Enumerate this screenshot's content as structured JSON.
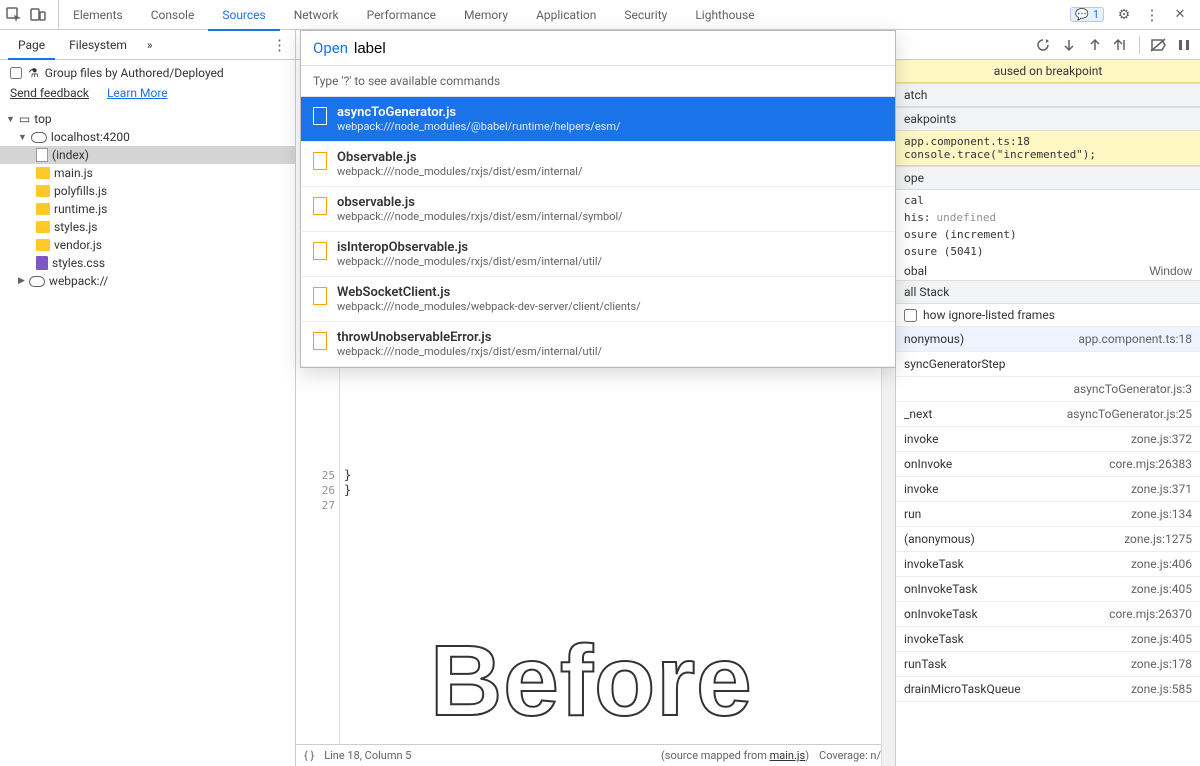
{
  "top_tabs": [
    "Elements",
    "Console",
    "Sources",
    "Network",
    "Performance",
    "Memory",
    "Application",
    "Security",
    "Lighthouse"
  ],
  "top_active": 2,
  "badge_count": "1",
  "second_tabs": {
    "page": "Page",
    "filesystem": "Filesystem"
  },
  "sidebar": {
    "group_label": "Group files by Authored/Deployed",
    "feedback": "Send feedback",
    "learn": "Learn More",
    "tree": {
      "top": "top",
      "host": "localhost:4200",
      "files": [
        "(index)",
        "main.js",
        "polyfills.js",
        "runtime.js",
        "styles.js",
        "vendor.js",
        "styles.css"
      ],
      "webpack": "webpack://"
    }
  },
  "palette": {
    "prefix": "Open",
    "input": "label",
    "hint": "Type '?' to see available commands",
    "items": [
      {
        "title": "asyncToGenerator.js",
        "path": "webpack:///node_modules/@babel/runtime/helpers/esm/"
      },
      {
        "title": "Observable.js",
        "path": "webpack:///node_modules/rxjs/dist/esm/internal/"
      },
      {
        "title": "observable.js",
        "path": "webpack:///node_modules/rxjs/dist/esm/internal/symbol/"
      },
      {
        "title": "isInteropObservable.js",
        "path": "webpack:///node_modules/rxjs/dist/esm/internal/util/"
      },
      {
        "title": "WebSocketClient.js",
        "path": "webpack:///node_modules/webpack-dev-server/client/clients/"
      },
      {
        "title": "throwUnobservableError.js",
        "path": "webpack:///node_modules/rxjs/dist/esm/internal/util/"
      }
    ]
  },
  "code": {
    "lines": [
      "25",
      "26",
      "27"
    ],
    "body": [
      "  }",
      "}",
      ""
    ]
  },
  "status": {
    "pos": "Line 18, Column 5",
    "mapped_pre": "(source mapped from ",
    "mapped_link": "main.js",
    "mapped_post": ")",
    "coverage": "Coverage: n/a"
  },
  "right": {
    "paused": "aused on breakpoint",
    "watch": "atch",
    "breakpoints": "eakpoints",
    "bp_line1": "app.component.ts:18",
    "bp_line2": "console.trace(\"incremented\");",
    "scope": "ope",
    "scope_items": [
      {
        "k": "cal",
        "v": ""
      },
      {
        "k": "his:",
        "v": "undefined"
      },
      {
        "k": "osure (increment)",
        "v": ""
      },
      {
        "k": "osure (5041)",
        "v": ""
      }
    ],
    "global_k": "obal",
    "global_v": "Window",
    "callstack": "all Stack",
    "ignore": "how ignore-listed frames",
    "stack": [
      {
        "fn": "nonymous)",
        "loc": "app.component.ts:18"
      },
      {
        "fn": "syncGeneratorStep",
        "loc": ""
      },
      {
        "fn": "",
        "loc": "asyncToGenerator.js:3"
      },
      {
        "fn": "_next",
        "loc": "asyncToGenerator.js:25"
      },
      {
        "fn": "invoke",
        "loc": "zone.js:372"
      },
      {
        "fn": "onInvoke",
        "loc": "core.mjs:26383"
      },
      {
        "fn": "invoke",
        "loc": "zone.js:371"
      },
      {
        "fn": "run",
        "loc": "zone.js:134"
      },
      {
        "fn": "(anonymous)",
        "loc": "zone.js:1275"
      },
      {
        "fn": "invokeTask",
        "loc": "zone.js:406"
      },
      {
        "fn": "onInvokeTask",
        "loc": "zone.js:405"
      },
      {
        "fn": "onInvokeTask",
        "loc": "core.mjs:26370"
      },
      {
        "fn": "invokeTask",
        "loc": "zone.js:405"
      },
      {
        "fn": "runTask",
        "loc": "zone.js:178"
      },
      {
        "fn": "drainMicroTaskQueue",
        "loc": "zone.js:585"
      }
    ]
  },
  "watermark": "Before"
}
